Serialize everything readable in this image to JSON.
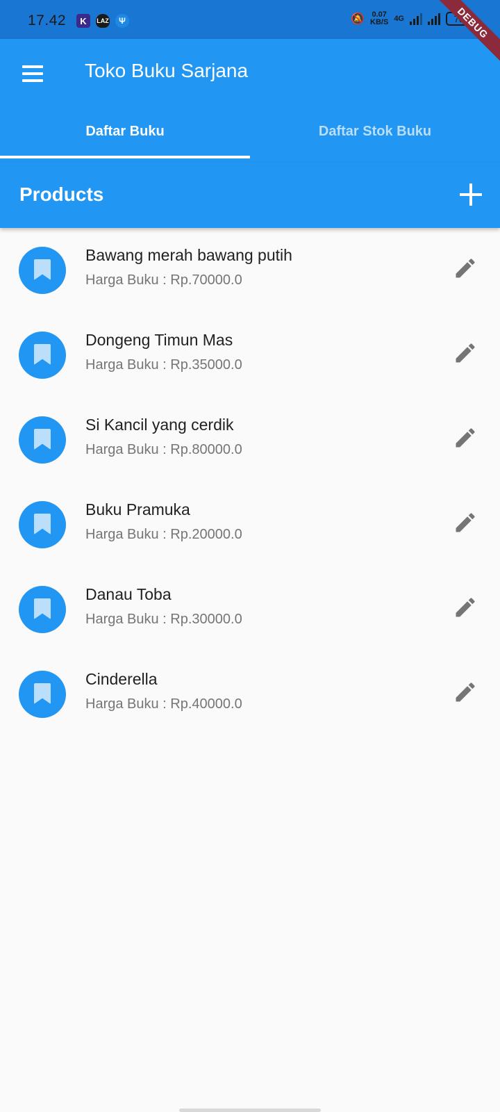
{
  "status_bar": {
    "time": "17.42",
    "notif_icons": [
      "K",
      "LAZ",
      "Ψ"
    ],
    "net_speed_value": "0.07",
    "net_speed_unit": "KB/S",
    "network_type": "4G",
    "battery": "78"
  },
  "debug_banner": "DEBUG",
  "app_bar": {
    "title": "Toko Buku Sarjana",
    "tabs": [
      {
        "label": "Daftar Buku",
        "active": true
      },
      {
        "label": "Daftar Stok Buku",
        "active": false
      }
    ]
  },
  "products": {
    "title": "Products",
    "items": [
      {
        "title": "Bawang merah bawang putih",
        "price": "Harga Buku : Rp.70000.0"
      },
      {
        "title": "Dongeng Timun Mas",
        "price": "Harga Buku : Rp.35000.0"
      },
      {
        "title": "Si Kancil yang cerdik",
        "price": "Harga Buku : Rp.80000.0"
      },
      {
        "title": "Buku Pramuka",
        "price": "Harga Buku : Rp.20000.0"
      },
      {
        "title": "Danau Toba",
        "price": "Harga Buku : Rp.30000.0"
      },
      {
        "title": "Cinderella",
        "price": "Harga Buku : Rp.40000.0"
      }
    ]
  },
  "icons": {
    "menu": "menu-icon",
    "add": "add-icon",
    "item_avatar": "bookmark-icon",
    "item_action": "edit-icon"
  },
  "colors": {
    "primary": "#2196f3",
    "status_bar": "#1976d2",
    "background": "#fafafa",
    "inactive_tab": "#bbdefb"
  }
}
